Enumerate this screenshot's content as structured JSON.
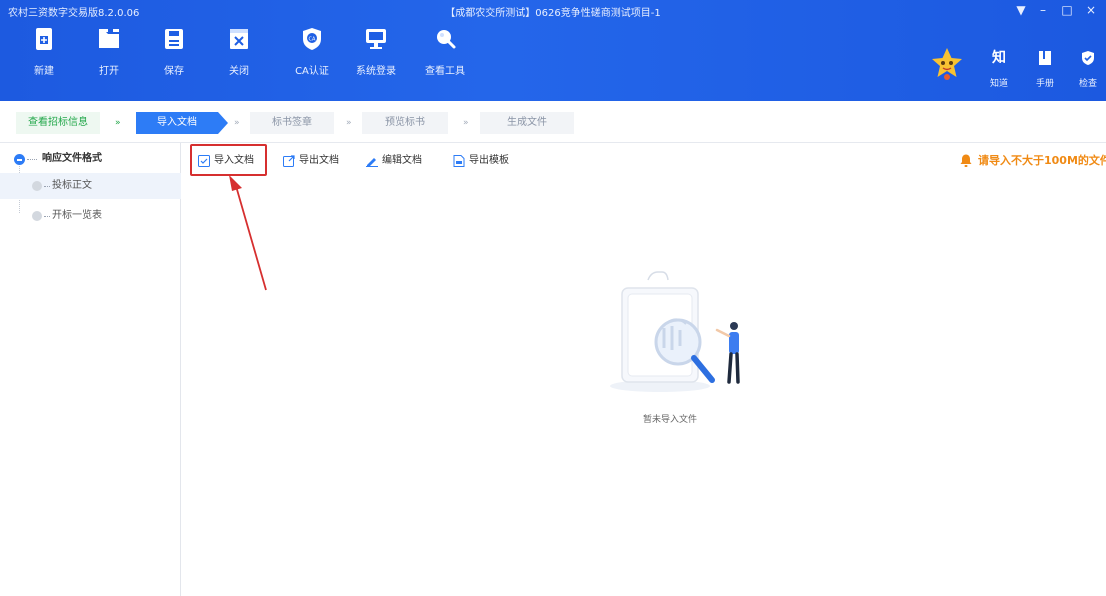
{
  "window": {
    "app_title": "农村三资数字交易版8.2.0.06",
    "document_title": "【成都农交所测试】0626竞争性磋商测试项目-1",
    "controls": [
      "▼",
      "–",
      "□",
      "×"
    ]
  },
  "toolbar": {
    "items": [
      {
        "label": "新建",
        "icon": "new-file-icon"
      },
      {
        "label": "打开",
        "icon": "open-folder-icon"
      },
      {
        "label": "保存",
        "icon": "save-icon"
      },
      {
        "label": "关闭",
        "icon": "close-file-icon"
      },
      {
        "label": "CA认证",
        "icon": "ca-shield-icon"
      },
      {
        "label": "系统登录",
        "icon": "monitor-icon"
      },
      {
        "label": "查看工具",
        "icon": "search-icon"
      }
    ],
    "right_items": [
      {
        "label": "知道",
        "glyph": "知",
        "icon": "knowledge-icon"
      },
      {
        "label": "手册",
        "icon": "manual-icon"
      },
      {
        "label": "检查",
        "icon": "check-shield-icon"
      }
    ]
  },
  "steps": {
    "items": [
      "查看招标信息",
      "导入文档",
      "标书签章",
      "预览标书",
      "生成文件"
    ],
    "separator": "»",
    "active_index": 1
  },
  "sidebar": {
    "root": "响应文件格式",
    "children": [
      "投标正文",
      "开标一览表"
    ],
    "selected_index": 0
  },
  "main_toolbar": {
    "import": "导入文档",
    "export": "导出文档",
    "edit": "编辑文档",
    "export_template": "导出模板"
  },
  "notice": "请导入不大于100M的文件",
  "empty_state": "暂未导入文件",
  "colors": {
    "brand_blue": "#1f5fe4",
    "step_active": "#2d7cf6",
    "step_done": "#23a74a",
    "notice_orange": "#f08a14",
    "highlight_red": "#d62f2f"
  }
}
